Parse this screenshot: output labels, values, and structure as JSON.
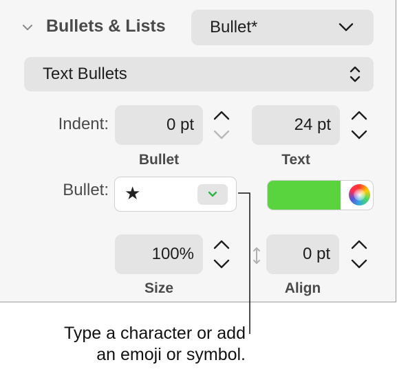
{
  "section": {
    "title": "Bullets & Lists",
    "style_popup": "Bullet*",
    "type_popup": "Text Bullets"
  },
  "indent": {
    "label": "Indent:",
    "bullet_value": "0 pt",
    "text_value": "24 pt",
    "bullet_caption": "Bullet",
    "text_caption": "Text"
  },
  "bullet": {
    "label": "Bullet:",
    "character": "★",
    "color": "#59d43e"
  },
  "size_align": {
    "size_value": "100%",
    "size_caption": "Size",
    "align_value": "0 pt",
    "align_caption": "Align"
  },
  "callout": {
    "line1": "Type a character or add",
    "line2": "an emoji or symbol."
  }
}
